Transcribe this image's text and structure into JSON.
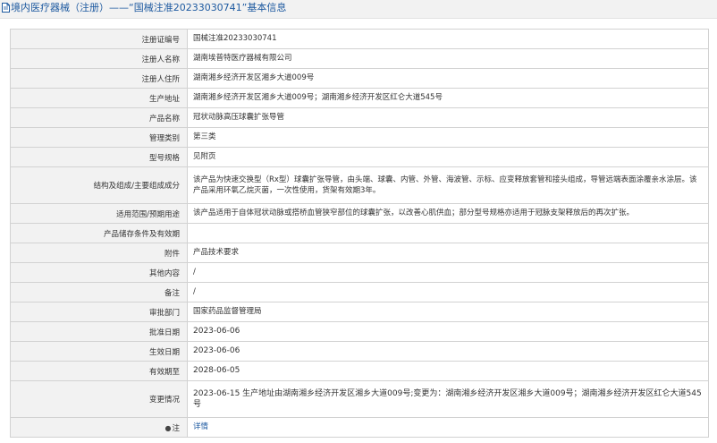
{
  "header": {
    "icon": "document-icon",
    "title": "境内医疗器械（注册）——“国械注准20233030741”基本信息"
  },
  "rows": [
    {
      "label": "注册证编号",
      "value": "国械注准20233030741"
    },
    {
      "label": "注册人名称",
      "value": "湖南埃普特医疗器械有限公司"
    },
    {
      "label": "注册人住所",
      "value": "湖南湘乡经济开发区湘乡大道009号"
    },
    {
      "label": "生产地址",
      "value": "湖南湘乡经济开发区湘乡大道009号；湖南湘乡经济开发区红仑大道545号"
    },
    {
      "label": "产品名称",
      "value": "冠状动脉高压球囊扩张导管"
    },
    {
      "label": "管理类别",
      "value": "第三类"
    },
    {
      "label": "型号规格",
      "value": "见附页"
    },
    {
      "label": "结构及组成/主要组成成分",
      "value": "该产品为快速交换型（Rx型）球囊扩张导管，由头端、球囊、内管、外管、海波管、示标、应变释放套管和接头组成，导管远端表面涂覆亲水涂层。该产品采用环氧乙烷灭菌，一次性使用，货架有效期3年。"
    },
    {
      "label": "适用范围/预期用途",
      "value": "该产品适用于自体冠状动脉或搭桥血管狭窄部位的球囊扩张，以改善心肌供血；部分型号规格亦适用于冠脉支架释放后的再次扩张。"
    },
    {
      "label": "产品储存条件及有效期",
      "value": ""
    },
    {
      "label": "附件",
      "value": "产品技术要求"
    },
    {
      "label": "其他内容",
      "value": "/"
    },
    {
      "label": "备注",
      "value": "/"
    },
    {
      "label": "审批部门",
      "value": "国家药品监督管理局"
    },
    {
      "label": "批准日期",
      "value": "2023-06-06"
    },
    {
      "label": "生效日期",
      "value": "2023-06-06"
    },
    {
      "label": "有效期至",
      "value": "2028-06-05"
    },
    {
      "label": "变更情况",
      "value": "2023-06-15 生产地址由湖南湘乡经济开发区湘乡大道009号;变更为：湖南湘乡经济开发区湘乡大道009号；湖南湘乡经济开发区红仑大道545号"
    },
    {
      "label": "注",
      "label_prefix": "●",
      "value": "详情"
    }
  ]
}
